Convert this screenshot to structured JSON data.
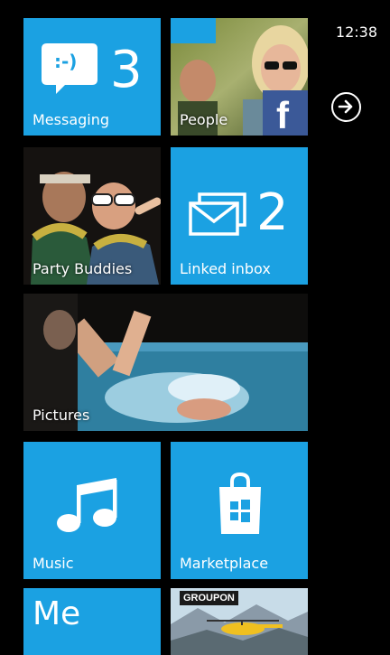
{
  "status_bar": {
    "time": "12:38"
  },
  "tiles": {
    "messaging": {
      "label": "Messaging",
      "count": "3",
      "icon": "speech-bubble-smiley-icon",
      "emoticon": ":-)"
    },
    "people": {
      "label": "People",
      "badge": "f",
      "badge_icon": "facebook-icon"
    },
    "party_buddies": {
      "label": "Party Buddies"
    },
    "linked_inbox": {
      "label": "Linked inbox",
      "count": "2",
      "icon": "envelopes-icon"
    },
    "pictures": {
      "label": "Pictures"
    },
    "music": {
      "label": "Music",
      "icon": "music-note-icon"
    },
    "marketplace": {
      "label": "Marketplace",
      "icon": "shopping-bag-icon"
    },
    "me": {
      "label": "Me"
    },
    "groupon": {
      "badge": "GROUPON"
    }
  },
  "colors": {
    "accent": "#1ba1e2",
    "background": "#000000",
    "facebook": "#3b5998"
  }
}
